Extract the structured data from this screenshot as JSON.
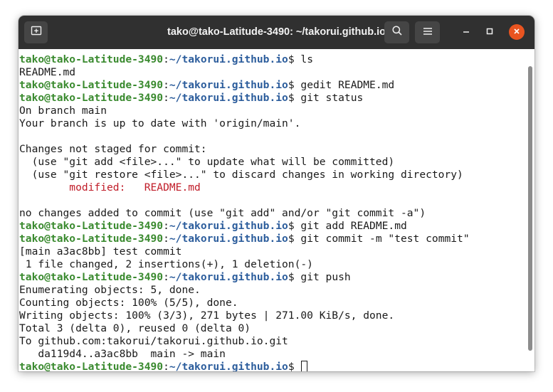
{
  "window": {
    "title": "tako@tako-Latitude-3490: ~/takorui.github.io"
  },
  "icons": {
    "new_tab": "new-tab-icon",
    "search": "search-icon",
    "menu": "hamburger-menu-icon",
    "minimize": "minimize-icon",
    "maximize": "maximize-icon",
    "close": "close-icon"
  },
  "colors": {
    "titlebar": "#303030",
    "prompt_user": "#3a8a2f",
    "prompt_path": "#2c5d9c",
    "modified": "#c01c28",
    "close_button": "#e95420"
  },
  "prompt": {
    "user_host": "tako@tako-Latitude-3490",
    "separator": ":",
    "path": "~/takorui.github.io",
    "symbol": "$ "
  },
  "lines": [
    {
      "type": "prompt",
      "command": "ls"
    },
    {
      "type": "output",
      "text": "README.md"
    },
    {
      "type": "prompt",
      "command": "gedit README.md"
    },
    {
      "type": "prompt",
      "command": "git status"
    },
    {
      "type": "output",
      "text": "On branch main"
    },
    {
      "type": "output",
      "text": "Your branch is up to date with 'origin/main'."
    },
    {
      "type": "output",
      "text": ""
    },
    {
      "type": "output",
      "text": "Changes not staged for commit:"
    },
    {
      "type": "output",
      "text": "  (use \"git add <file>...\" to update what will be committed)"
    },
    {
      "type": "output",
      "text": "  (use \"git restore <file>...\" to discard changes in working directory)"
    },
    {
      "type": "modified",
      "text": "\tmodified:   README.md"
    },
    {
      "type": "output",
      "text": ""
    },
    {
      "type": "output",
      "text": "no changes added to commit (use \"git add\" and/or \"git commit -a\")"
    },
    {
      "type": "prompt",
      "command": "git add README.md"
    },
    {
      "type": "prompt",
      "command": "git commit -m \"test commit\""
    },
    {
      "type": "output",
      "text": "[main a3ac8bb] test commit"
    },
    {
      "type": "output",
      "text": " 1 file changed, 2 insertions(+), 1 deletion(-)"
    },
    {
      "type": "prompt",
      "command": "git push"
    },
    {
      "type": "output",
      "text": "Enumerating objects: 5, done."
    },
    {
      "type": "output",
      "text": "Counting objects: 100% (5/5), done."
    },
    {
      "type": "output",
      "text": "Writing objects: 100% (3/3), 271 bytes | 271.00 KiB/s, done."
    },
    {
      "type": "output",
      "text": "Total 3 (delta 0), reused 0 (delta 0)"
    },
    {
      "type": "output",
      "text": "To github.com:takorui/takorui.github.io.git"
    },
    {
      "type": "output",
      "text": "   da119d4..a3ac8bb  main -> main"
    },
    {
      "type": "prompt",
      "command": "",
      "cursor": true
    }
  ]
}
